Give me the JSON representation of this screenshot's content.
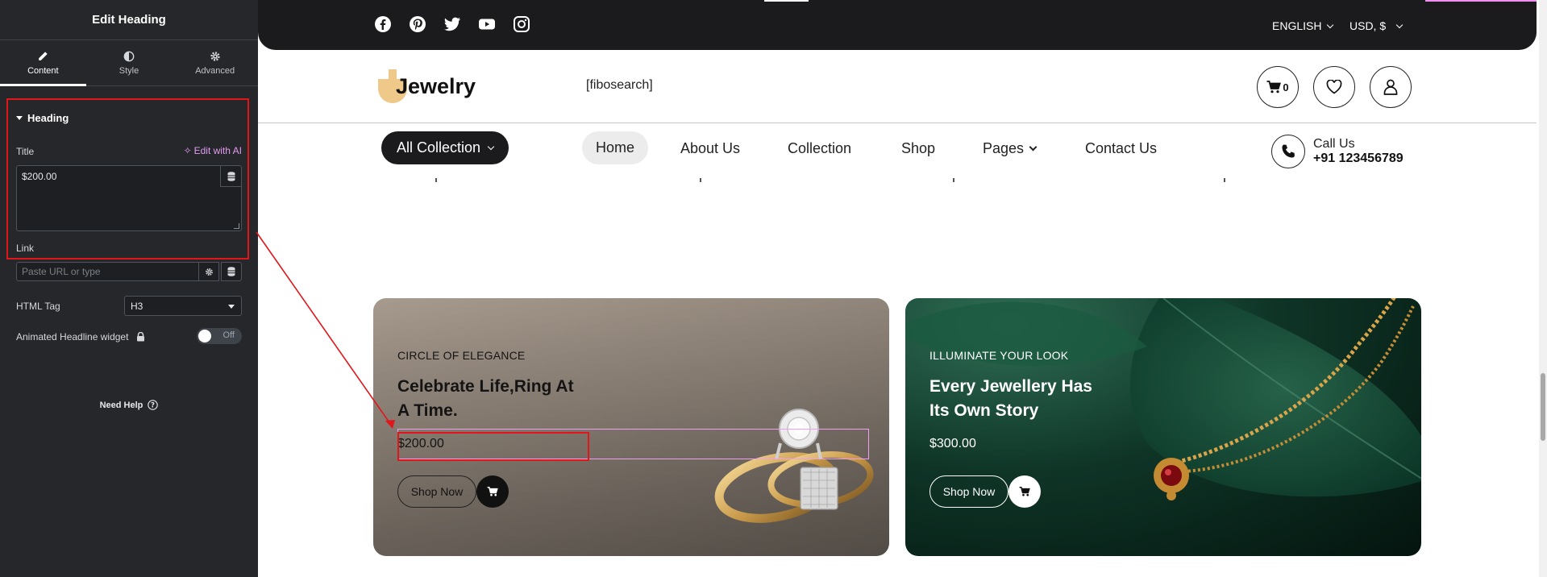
{
  "editor": {
    "title": "Edit Heading",
    "tabs": [
      {
        "label": "Content",
        "icon": "pencil-icon"
      },
      {
        "label": "Style",
        "icon": "half-circle-icon"
      },
      {
        "label": "Advanced",
        "icon": "gear-icon"
      }
    ],
    "section_title": "Heading",
    "title_label": "Title",
    "edit_ai": "Edit with AI",
    "title_value": "$200.00",
    "link_label": "Link",
    "link_placeholder": "Paste URL or type",
    "html_tag_label": "HTML Tag",
    "html_tag_value": "H3",
    "animated_label": "Animated Headline widget",
    "toggle_text": "Off",
    "need_help": "Need Help"
  },
  "site": {
    "social_icons": [
      "facebook-icon",
      "pinterest-icon",
      "twitter-icon",
      "youtube-icon",
      "instagram-icon"
    ],
    "language": "ENGLISH",
    "currency": "USD, $",
    "logo_text": "Jewelry",
    "search_shortcode": "[fibosearch]",
    "cart_count": "0",
    "all_collection": "All Collection",
    "nav": {
      "home": "Home",
      "about": "About Us",
      "collection": "Collection",
      "shop": "Shop",
      "pages": "Pages",
      "contact": "Contact Us"
    },
    "call_label": "Call Us",
    "call_number": "+91 123456789",
    "banners": [
      {
        "eyebrow": "CIRCLE OF ELEGANCE",
        "headline": "Celebrate Life,Ring At A Time.",
        "price": "$200.00",
        "button": "Shop Now"
      },
      {
        "eyebrow": "ILLUMINATE YOUR LOOK",
        "headline": "Every Jewellery Has Its Own Story",
        "price": "$300.00",
        "button": "Shop Now"
      }
    ]
  },
  "colors": {
    "panel_bg": "#26272b",
    "topbar_bg": "#1b1b1d",
    "ai_accent": "#e39cf2",
    "highlight_red": "#e0161a"
  }
}
